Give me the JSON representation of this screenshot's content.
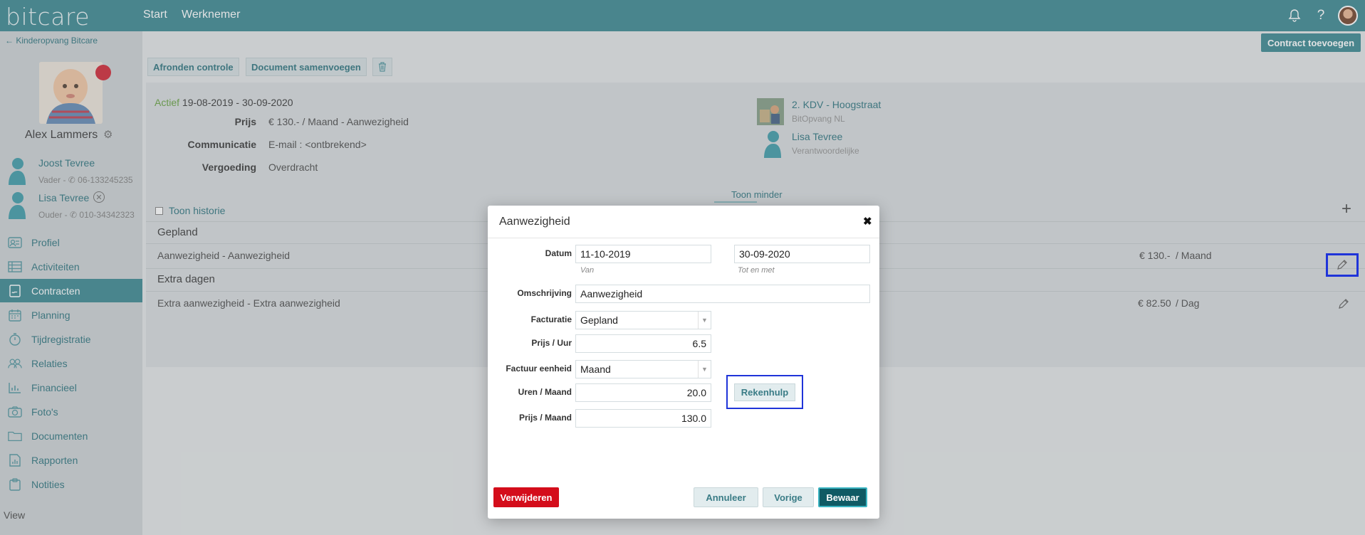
{
  "topbar": {
    "logo": "bitcare",
    "nav": [
      "Start",
      "Werknemer"
    ],
    "icons": [
      "bell-icon",
      "help-icon"
    ]
  },
  "sidebar": {
    "back_link": "← Kinderopvang Bitcare",
    "child_name": "Alex Lammers",
    "relations": [
      {
        "name": "Joost Tevree",
        "sub": "Vader - ✆ 06-133245235"
      },
      {
        "name": "Lisa Tevree",
        "sub": "Ouder - ✆ 010-34342323"
      }
    ],
    "menu": [
      {
        "label": "Profiel",
        "icon": "id-card-icon"
      },
      {
        "label": "Activiteiten",
        "icon": "list-icon"
      },
      {
        "label": "Contracten",
        "icon": "contract-icon"
      },
      {
        "label": "Planning",
        "icon": "calendar-icon"
      },
      {
        "label": "Tijdregistratie",
        "icon": "stopwatch-icon"
      },
      {
        "label": "Relaties",
        "icon": "people-icon"
      },
      {
        "label": "Financieel",
        "icon": "bar-chart-icon"
      },
      {
        "label": "Foto's",
        "icon": "camera-icon"
      },
      {
        "label": "Documenten",
        "icon": "folder-icon"
      },
      {
        "label": "Rapporten",
        "icon": "report-icon"
      },
      {
        "label": "Notities",
        "icon": "clipboard-icon"
      }
    ],
    "active_item": "Contracten",
    "view_label": "View"
  },
  "main": {
    "toolbar": {
      "afronden": "Afronden controle",
      "samenvoegen": "Document samenvoegen"
    },
    "contract_add": "Contract toevoegen",
    "contract": {
      "status": "Actief",
      "period": "19-08-2019 - 30-09-2020",
      "prijs_label": "Prijs",
      "prijs_value": "€ 130.- / Maand - Aanwezigheid",
      "communicatie_label": "Communicatie",
      "communicatie_value": "E-mail : <ontbrekend>",
      "vergoeding_label": "Vergoeding",
      "vergoeding_value": "Overdracht",
      "location_name": "2. KDV - Hoogstraat",
      "location_org": "BitOpvang NL",
      "contact_name": "Lisa Tevree",
      "contact_role": "Verantwoordelijke"
    },
    "toon_minder": "Toon minder",
    "toon_historie": "Toon historie",
    "add_symbol": "+",
    "sections": {
      "gepland": "Gepland",
      "extra": "Extra dagen"
    },
    "rows": [
      {
        "label": "Aanwezigheid - Aanwezigheid",
        "price": "€ 130.-",
        "unit": "/ Maand"
      },
      {
        "label": "Extra aanwezigheid - Extra aanwezigheid",
        "price": "€ 82.50",
        "unit": "/ Dag"
      }
    ]
  },
  "modal": {
    "title": "Aanwezigheid",
    "close": "✖",
    "datum_label": "Datum",
    "datum_van": "11-10-2019",
    "datum_tot": "30-09-2020",
    "van_hint": "Van",
    "tot_hint": "Tot en met",
    "omschrijving_label": "Omschrijving",
    "omschrijving_value": "Aanwezigheid",
    "facturatie_label": "Facturatie",
    "facturatie_value": "Gepland",
    "prijs_uur_label": "Prijs / Uur",
    "prijs_uur_value": "6.5",
    "factuur_eenheid_label": "Factuur eenheid",
    "factuur_eenheid_value": "Maand",
    "uren_maand_label": "Uren / Maand",
    "uren_maand_value": "20.0",
    "prijs_maand_label": "Prijs / Maand",
    "prijs_maand_value": "130.0",
    "rekenhulp": "Rekenhulp",
    "verwijderen": "Verwijderen",
    "annuleer": "Annuleer",
    "vorige": "Vorige",
    "bewaar": "Bewaar"
  }
}
